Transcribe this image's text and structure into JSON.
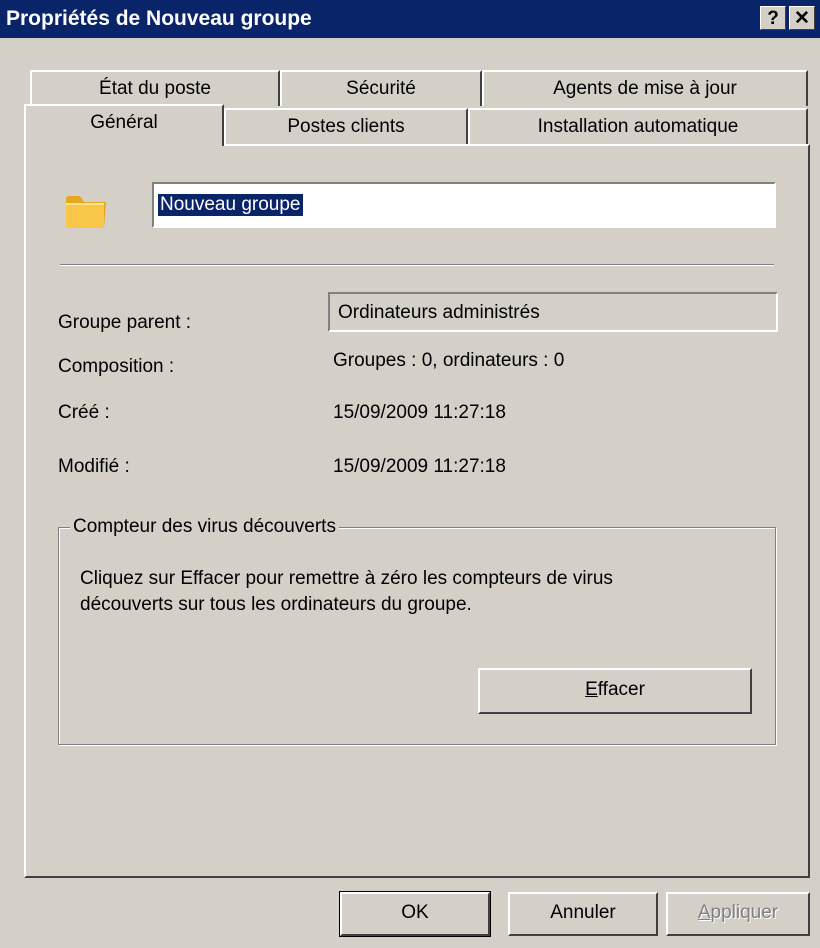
{
  "window": {
    "title": "Propriétés de Nouveau groupe",
    "help_button": "?",
    "close_button": "✕"
  },
  "tabs_back_row": [
    "État du poste",
    "Sécurité",
    "Agents de mise à jour"
  ],
  "tabs_front_row": [
    "Général",
    "Postes clients",
    "Installation automatique"
  ],
  "active_tab": "Général",
  "general": {
    "group_name_value": "Nouveau groupe",
    "parent_label": "Groupe parent :",
    "parent_value": "Ordinateurs administrés",
    "composition_label": "Composition :",
    "composition_value": "Groupes : 0, ordinateurs : 0",
    "created_label": "Créé :",
    "created_value": "15/09/2009 11:27:18",
    "modified_label": "Modifié :",
    "modified_value": "15/09/2009 11:27:18"
  },
  "virus_counter": {
    "legend": "Compteur des virus découverts",
    "description_line1": "Cliquez sur Effacer pour remettre à zéro les compteurs de virus",
    "description_line2": "découverts sur tous les ordinateurs du groupe.",
    "clear_button_mnemonic": "E",
    "clear_button_rest": "ffacer"
  },
  "footer": {
    "ok_label": "OK",
    "cancel_label": "Annuler",
    "apply_mnemonic": "A",
    "apply_rest": "ppliquer"
  },
  "colors": {
    "titlebar": "#0a246a",
    "dialog_bg": "#d4d0c8",
    "folder": "#f5c542"
  },
  "icons": {
    "group": "folder-icon"
  }
}
